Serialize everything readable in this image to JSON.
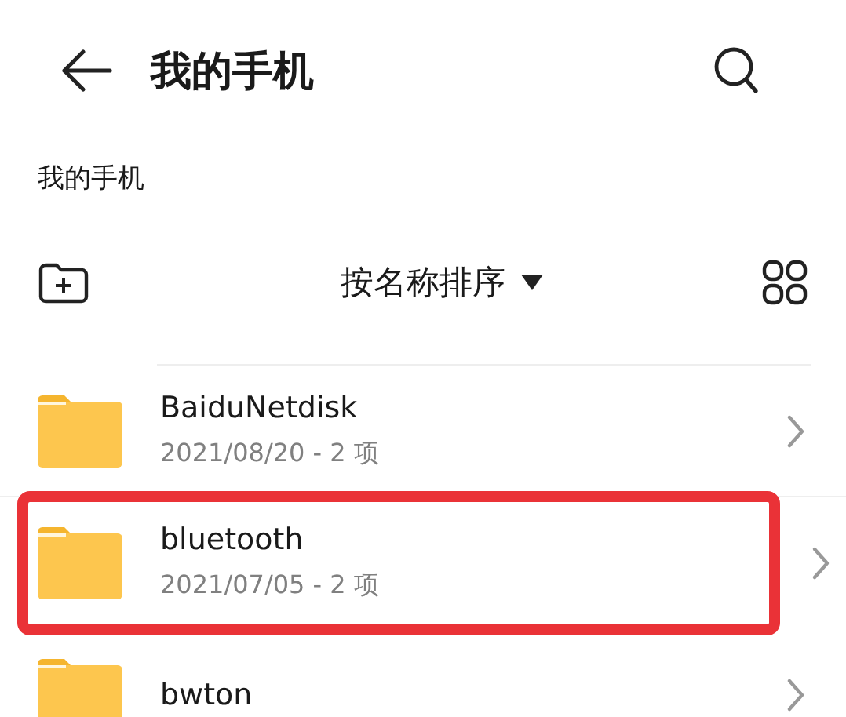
{
  "header": {
    "title": "我的手机"
  },
  "breadcrumb": "我的手机",
  "toolbar": {
    "sort_label": "按名称排序"
  },
  "folders": [
    {
      "name": "BaiduNetdisk",
      "meta": "2021/08/20 - 2 项",
      "highlighted": false
    },
    {
      "name": "bluetooth",
      "meta": "2021/07/05 - 2 项",
      "highlighted": true
    },
    {
      "name": "bwton",
      "highlighted": false
    }
  ]
}
